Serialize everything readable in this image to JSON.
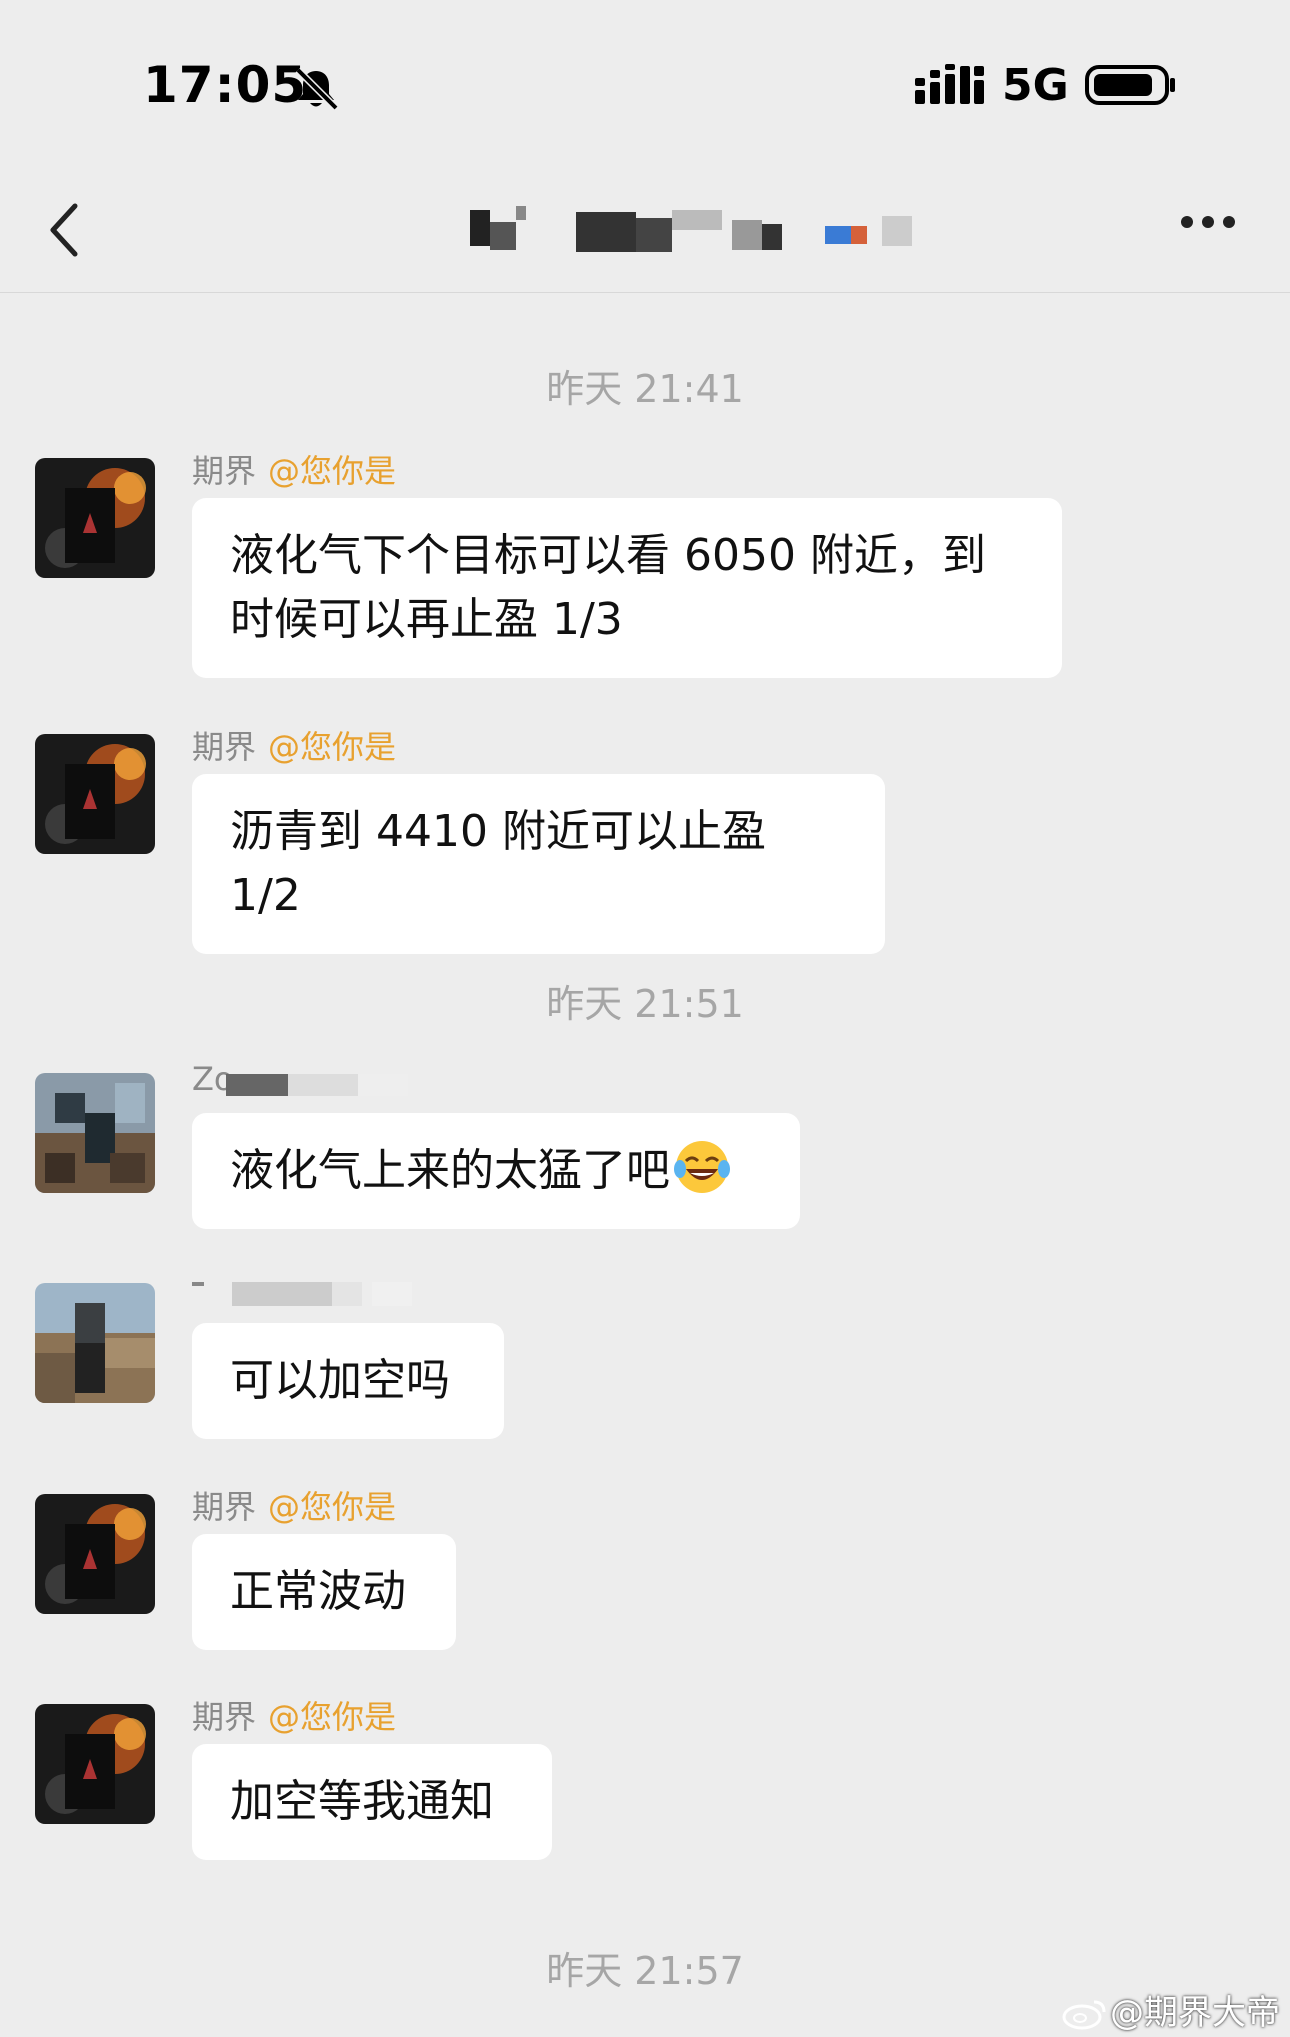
{
  "status_bar": {
    "time": "17:05",
    "network": "5G"
  },
  "nav": {
    "back_icon": "chevron-left-icon",
    "more_icon": "more-dots-icon"
  },
  "timestamps": [
    "昨天 21:41",
    "昨天 21:51",
    "昨天 21:57"
  ],
  "messages": [
    {
      "sender": "期界",
      "mention": "@您你是",
      "text": "液化气下个目标可以看 6050 附近，到时候可以再止盈 1/3"
    },
    {
      "sender": "期界",
      "mention": "@您你是",
      "text": "沥青到 4410 附近可以止盈 1/2"
    },
    {
      "sender": "Zo",
      "text": "液化气上来的太猛了吧",
      "emoji": "laughing-tears-emoji"
    },
    {
      "sender": "",
      "text": "可以加空吗"
    },
    {
      "sender": "期界",
      "mention": "@您你是",
      "text": "正常波动"
    },
    {
      "sender": "期界",
      "mention": "@您你是",
      "text": "加空等我通知"
    }
  ],
  "watermark": "@期界大帝",
  "colors": {
    "background": "#ededed",
    "bubble": "#ffffff",
    "mention": "#e8a12f",
    "meta": "#8a8a8a"
  }
}
